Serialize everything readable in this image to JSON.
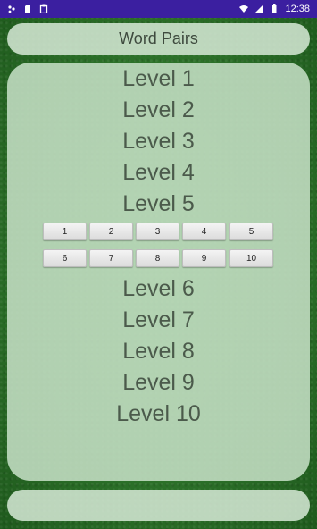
{
  "status_bar": {
    "time": "12:38",
    "left_icons": [
      "notification-icon",
      "sd-card-icon",
      "clipboard-icon"
    ],
    "right_icons": [
      "wifi-icon",
      "signal-icon",
      "battery-icon"
    ]
  },
  "header": {
    "title": "Word Pairs"
  },
  "levels_top": [
    "Level 1",
    "Level 2",
    "Level 3",
    "Level 4",
    "Level 5"
  ],
  "buttons_row1": [
    "1",
    "2",
    "3",
    "4",
    "5"
  ],
  "buttons_row2": [
    "6",
    "7",
    "8",
    "9",
    "10"
  ],
  "levels_bottom": [
    "Level 6",
    "Level 7",
    "Level 8",
    "Level 9",
    "Level 10"
  ],
  "colors": {
    "status_bar": "#3b1fa0",
    "background": "#2f7a2c",
    "panel": "#c4dec4",
    "text": "#4b5a4b"
  }
}
